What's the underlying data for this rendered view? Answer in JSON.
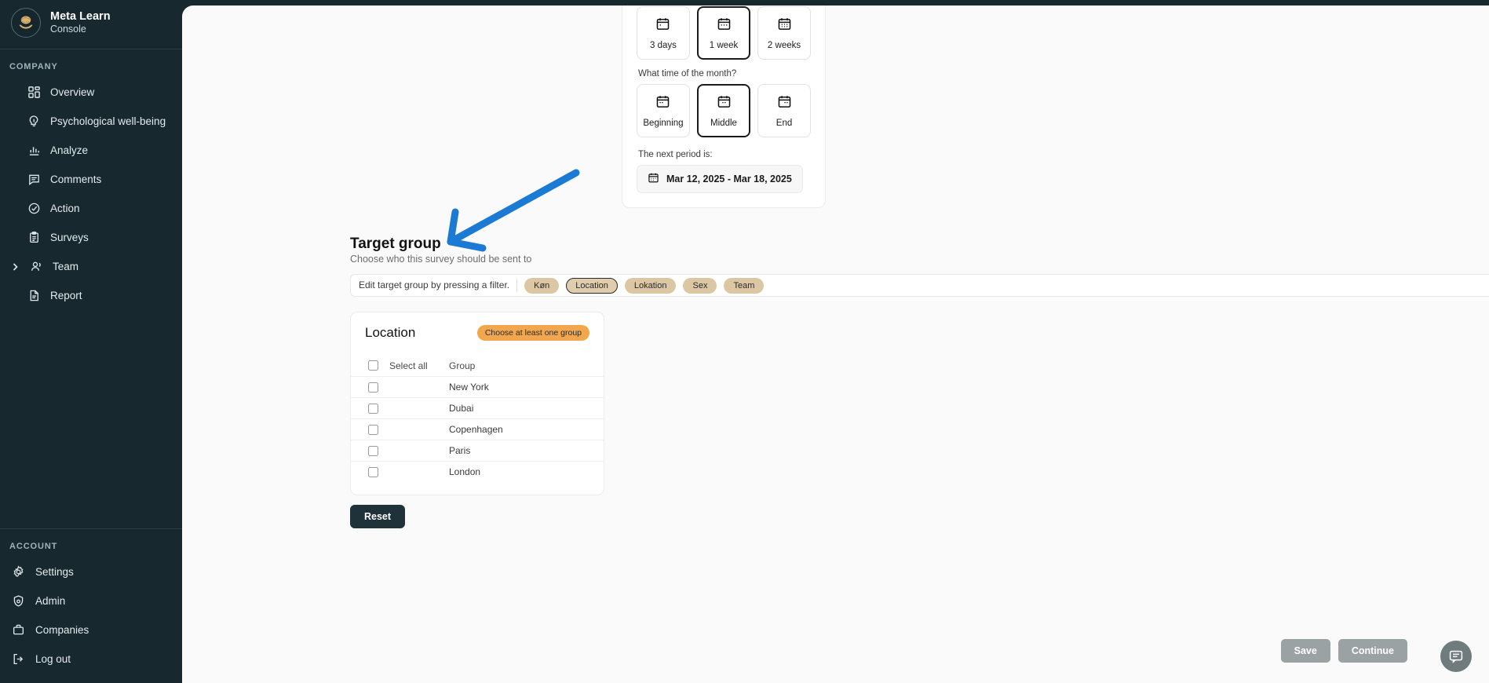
{
  "brand": {
    "title": "Meta Learn",
    "subtitle": "Console",
    "logo_icon": "brain-in-hand-logo"
  },
  "sidebar": {
    "company_label": "COMPANY",
    "account_label": "ACCOUNT",
    "company_items": [
      {
        "label": "Overview",
        "icon": "dashboard-icon",
        "chevron": false
      },
      {
        "label": "Psychological well-being",
        "icon": "brain-lightbulb-icon",
        "chevron": false
      },
      {
        "label": "Analyze",
        "icon": "bar-chart-icon",
        "chevron": false
      },
      {
        "label": "Comments",
        "icon": "comment-icon",
        "chevron": false
      },
      {
        "label": "Action",
        "icon": "check-circle-icon",
        "chevron": false
      },
      {
        "label": "Surveys",
        "icon": "clipboard-icon",
        "chevron": false
      },
      {
        "label": "Team",
        "icon": "users-icon",
        "chevron": true
      },
      {
        "label": "Report",
        "icon": "document-icon",
        "chevron": false
      }
    ],
    "account_items": [
      {
        "label": "Settings",
        "icon": "gear-icon"
      },
      {
        "label": "Admin",
        "icon": "shield-user-icon"
      },
      {
        "label": "Companies",
        "icon": "briefcase-icon"
      },
      {
        "label": "Log out",
        "icon": "logout-icon"
      }
    ]
  },
  "schedule": {
    "duration_options": [
      {
        "label": "3 days",
        "icon": "calendar-icon",
        "selected": false
      },
      {
        "label": "1 week",
        "icon": "calendar-icon",
        "selected": true
      },
      {
        "label": "2 weeks",
        "icon": "calendar-icon",
        "selected": false
      }
    ],
    "month_question": "What time of the month?",
    "month_options": [
      {
        "label": "Beginning",
        "icon": "calendar-icon",
        "selected": false
      },
      {
        "label": "Middle",
        "icon": "calendar-icon",
        "selected": true
      },
      {
        "label": "End",
        "icon": "calendar-icon",
        "selected": false
      }
    ],
    "next_period_label": "The next period is:",
    "next_period_value": "Mar 12, 2025 - Mar 18, 2025",
    "next_period_icon": "calendar-icon"
  },
  "target_group": {
    "title": "Target group",
    "subtitle": "Choose who this survey should be sent to",
    "filter_hint": "Edit target group by pressing a filter.",
    "filters": [
      {
        "label": "Køn",
        "active": false
      },
      {
        "label": "Location",
        "active": true
      },
      {
        "label": "Lokation",
        "active": false
      },
      {
        "label": "Sex",
        "active": false
      },
      {
        "label": "Team",
        "active": false
      }
    ]
  },
  "location_card": {
    "title": "Location",
    "badge": "Choose at least one group",
    "select_all_label": "Select all",
    "group_column_label": "Group",
    "rows": [
      {
        "name": "New York",
        "checked": false
      },
      {
        "name": "Dubai",
        "checked": false
      },
      {
        "name": "Copenhagen",
        "checked": false
      },
      {
        "name": "Paris",
        "checked": false
      },
      {
        "name": "London",
        "checked": false
      }
    ]
  },
  "actions": {
    "reset_label": "Reset",
    "save_label": "Save",
    "continue_label": "Continue",
    "chat_icon": "chat-bubble-icon"
  },
  "annotation": {
    "arrow_color": "#1a7ad4",
    "arrow_icon": "arrow-pointer"
  },
  "colors": {
    "sidebar_bg": "#17282f",
    "content_bg": "#fafafa",
    "chip_bg": "#dcc7a4",
    "badge_bg": "#f2a74e",
    "accent_blue": "#1a7ad4",
    "button_disabled": "#9aa2a4"
  }
}
